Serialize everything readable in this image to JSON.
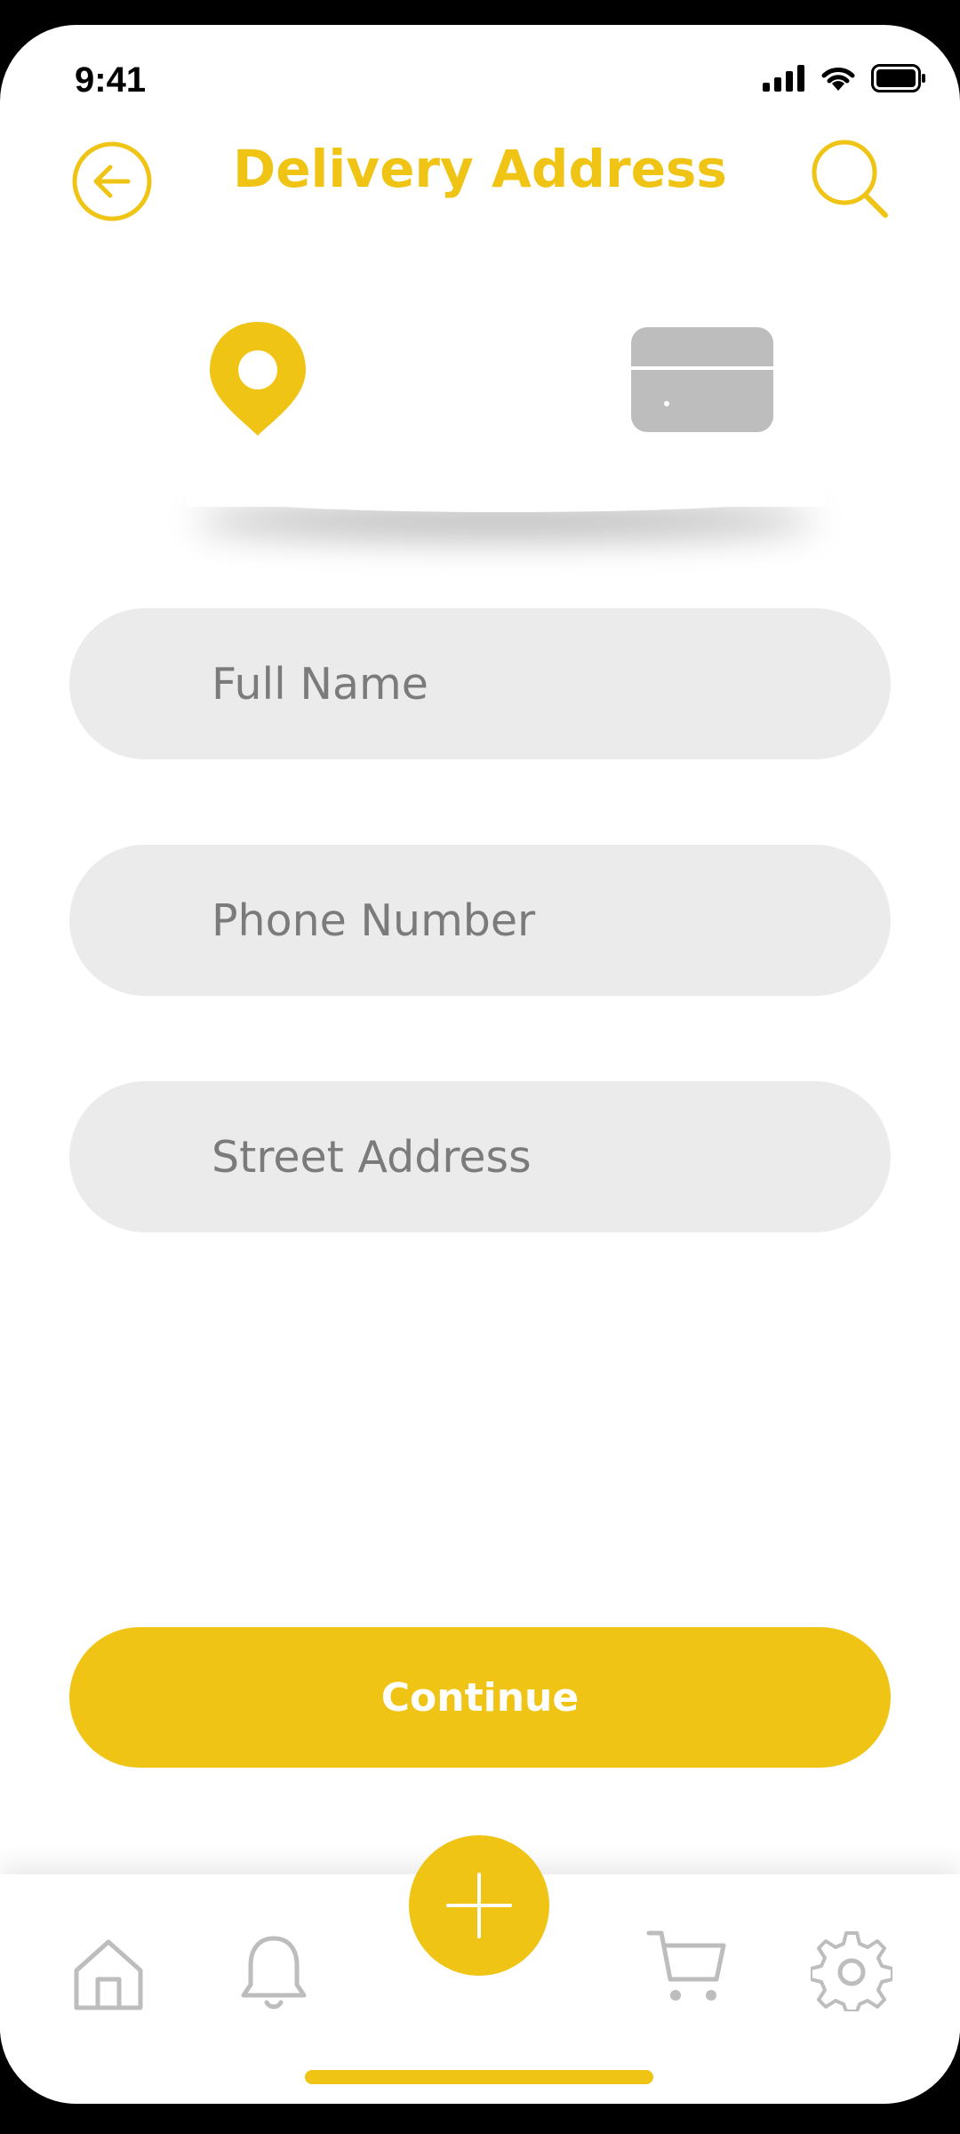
{
  "status": {
    "time": "9:41"
  },
  "header": {
    "title": "Delivery Address",
    "back_icon": "arrow-left-circle-icon",
    "search_icon": "search-icon"
  },
  "steps": {
    "active_icon": "location-pin-icon",
    "inactive_icon": "credit-card-icon"
  },
  "form": {
    "full_name_placeholder": "Full Name",
    "phone_placeholder": "Phone Number",
    "street_placeholder": "Street Address"
  },
  "actions": {
    "continue_label": "Continue"
  },
  "tabbar": {
    "items": [
      "home-icon",
      "bell-icon",
      "plus-icon",
      "cart-icon",
      "gear-icon"
    ]
  },
  "colors": {
    "accent": "#F0C414",
    "field_bg": "#EBEBEB",
    "inactive_icon": "#BDBDBD"
  }
}
